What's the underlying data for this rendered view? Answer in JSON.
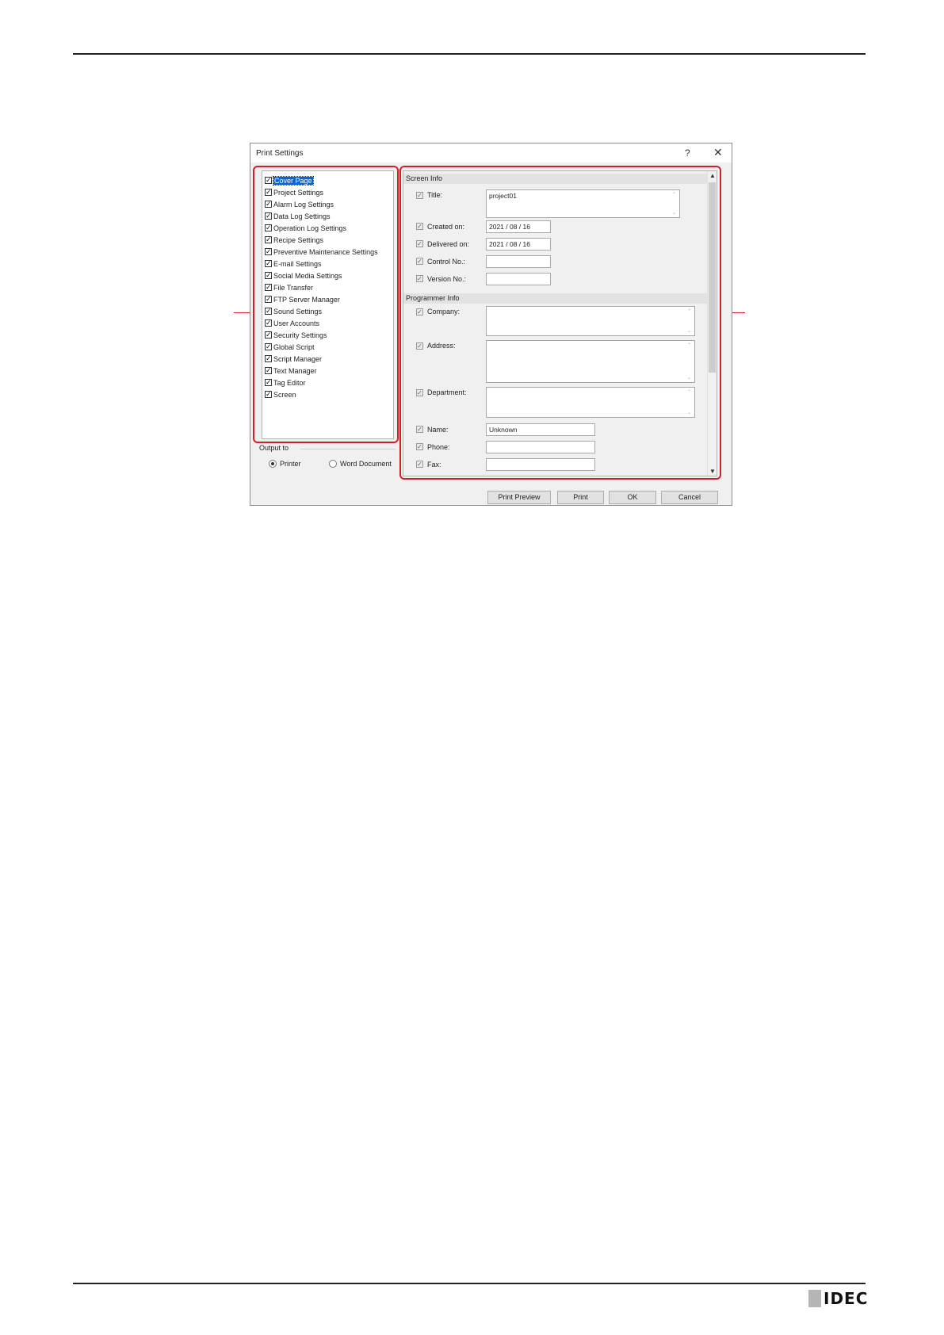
{
  "dialog": {
    "title": "Print Settings",
    "help_glyph": "?",
    "close_glyph": "✕"
  },
  "tree": {
    "items": [
      {
        "label": "Cover Page",
        "checked": true,
        "selected": true
      },
      {
        "label": "Project Settings",
        "checked": true
      },
      {
        "label": "Alarm Log Settings",
        "checked": true
      },
      {
        "label": "Data Log Settings",
        "checked": true
      },
      {
        "label": "Operation Log Settings",
        "checked": true
      },
      {
        "label": "Recipe Settings",
        "checked": true
      },
      {
        "label": "Preventive Maintenance Settings",
        "checked": true
      },
      {
        "label": "E-mail Settings",
        "checked": true
      },
      {
        "label": "Social Media Settings",
        "checked": true
      },
      {
        "label": "File Transfer",
        "checked": true
      },
      {
        "label": "FTP Server Manager",
        "checked": true
      },
      {
        "label": "Sound Settings",
        "checked": true
      },
      {
        "label": "User Accounts",
        "checked": true
      },
      {
        "label": "Security Settings",
        "checked": true
      },
      {
        "label": "Global Script",
        "checked": true
      },
      {
        "label": "Script Manager",
        "checked": true
      },
      {
        "label": "Text Manager",
        "checked": true
      },
      {
        "label": "Tag Editor",
        "checked": true
      },
      {
        "label": "Screen",
        "checked": true
      }
    ]
  },
  "output": {
    "label": "Output to",
    "options": [
      {
        "label": "Printer",
        "selected": true
      },
      {
        "label": "Word Document",
        "selected": false
      }
    ]
  },
  "screen_info": {
    "header": "Screen Info",
    "title": {
      "label": "Title:",
      "value": "project01"
    },
    "created_on": {
      "label": "Created on:",
      "value": "2021 / 08 / 16"
    },
    "delivered_on": {
      "label": "Delivered on:",
      "value": "2021 / 08 / 16"
    },
    "control_no": {
      "label": "Control No.:",
      "value": ""
    },
    "version_no": {
      "label": "Version No.:",
      "value": ""
    }
  },
  "programmer_info": {
    "header": "Programmer Info",
    "company": {
      "label": "Company:",
      "value": ""
    },
    "address": {
      "label": "Address:",
      "value": ""
    },
    "department": {
      "label": "Department:",
      "value": ""
    },
    "name": {
      "label": "Name:",
      "value": "Unknown"
    },
    "phone": {
      "label": "Phone:",
      "value": ""
    },
    "fax": {
      "label": "Fax:",
      "value": ""
    }
  },
  "buttons": {
    "print_preview": "Print Preview",
    "print": "Print",
    "ok": "OK",
    "cancel": "Cancel"
  },
  "glyphs": {
    "check": "✓",
    "scroll_up": "▲",
    "scroll_down": "▼",
    "caret_up": "⌃",
    "caret_down": "⌄"
  },
  "brand": {
    "logo_text": "IDEC",
    "accent_color": "#d0202a",
    "selection_color": "#0a64d6"
  }
}
